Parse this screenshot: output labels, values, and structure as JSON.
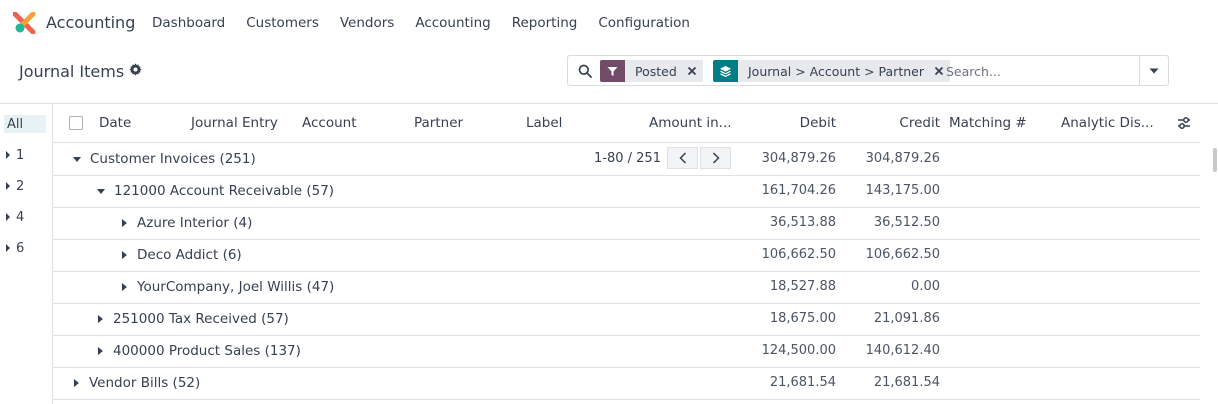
{
  "app": {
    "name": "Accounting"
  },
  "menu": [
    "Dashboard",
    "Customers",
    "Vendors",
    "Accounting",
    "Reporting",
    "Configuration"
  ],
  "page": {
    "title": "Journal Items"
  },
  "search": {
    "facets": [
      {
        "icon": "filter-icon",
        "label": "Posted",
        "color": "#714b67"
      },
      {
        "icon": "layers-icon",
        "label": "Journal > Account > Partner",
        "color": "#017e84"
      }
    ],
    "placeholder": "Search..."
  },
  "side_panel": {
    "items": [
      {
        "label": "All",
        "active": true
      },
      {
        "label": "1"
      },
      {
        "label": "2"
      },
      {
        "label": "4"
      },
      {
        "label": "6"
      }
    ]
  },
  "columns": [
    "Date",
    "Journal Entry",
    "Account",
    "Partner",
    "Label",
    "Amount in...",
    "Debit",
    "Credit",
    "Matching #",
    "Analytic Dis..."
  ],
  "pager": {
    "text": "1-80 / 251"
  },
  "groups": [
    {
      "label": "Customer Invoices (251)",
      "level": 0,
      "expanded": true,
      "debit": "304,879.26",
      "credit": "304,879.26"
    },
    {
      "label": "121000 Account Receivable (57)",
      "level": 1,
      "expanded": true,
      "debit": "161,704.26",
      "credit": "143,175.00"
    },
    {
      "label": "Azure Interior (4)",
      "level": 2,
      "expanded": false,
      "debit": "36,513.88",
      "credit": "36,512.50"
    },
    {
      "label": "Deco Addict (6)",
      "level": 2,
      "expanded": false,
      "debit": "106,662.50",
      "credit": "106,662.50"
    },
    {
      "label": "YourCompany, Joel Willis (47)",
      "level": 2,
      "expanded": false,
      "debit": "18,527.88",
      "credit": "0.00"
    },
    {
      "label": "251000 Tax Received (57)",
      "level": 1,
      "expanded": false,
      "debit": "18,675.00",
      "credit": "21,091.86"
    },
    {
      "label": "400000 Product Sales (137)",
      "level": 1,
      "expanded": false,
      "debit": "124,500.00",
      "credit": "140,612.40"
    },
    {
      "label": "Vendor Bills (52)",
      "level": 0,
      "expanded": false,
      "debit": "21,681.54",
      "credit": "21,681.54"
    }
  ]
}
